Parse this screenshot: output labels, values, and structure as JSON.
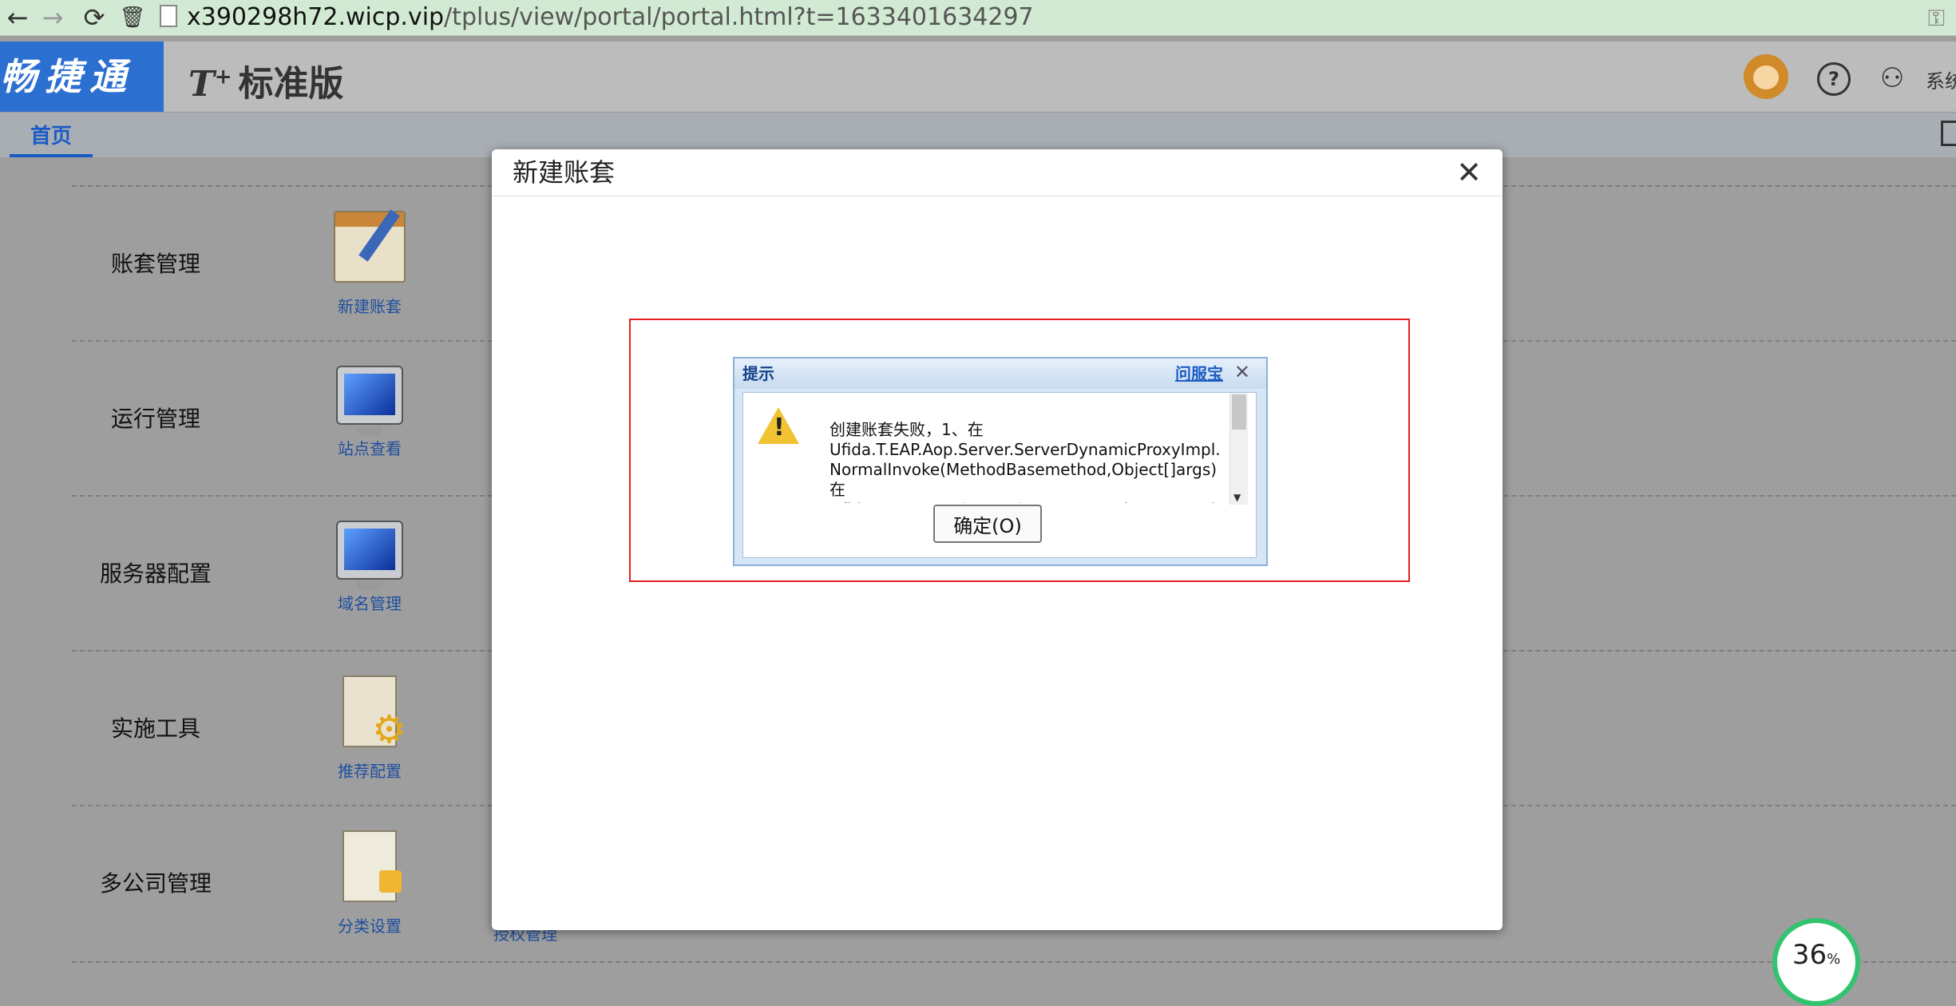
{
  "browser": {
    "back_icon": "←",
    "forward_icon": "→",
    "reload_icon": "⟳",
    "trash_icon": "🗑",
    "url_host": "x390298h72.wicp.vip",
    "url_path": "/tplus/view/portal/portal.html?t=1633401634297"
  },
  "header": {
    "brand": "畅捷通",
    "product_t": "T",
    "product_plus": "+",
    "product_name": "标准版",
    "user_truncated": "系统"
  },
  "tabs": [
    {
      "label": "首页"
    }
  ],
  "portal": {
    "rows": [
      {
        "title": "账套管理",
        "func": "新建账套"
      },
      {
        "title": "运行管理",
        "func": "站点查看"
      },
      {
        "title": "服务器配置",
        "func": "域名管理"
      },
      {
        "title": "实施工具",
        "func": "推荐配置"
      },
      {
        "title": "多公司管理",
        "func": "分类设置"
      }
    ],
    "peek_label": "授权管理"
  },
  "modal": {
    "title": "新建账套",
    "close_icon": "✕"
  },
  "dialog": {
    "title": "提示",
    "link": "问服宝",
    "close_icon": "✕",
    "message": "创建账套失败，1、在\nUfida.T.EAP.Aop.Server.ServerDynamicProxyImpl.NormalInvoke(MethodBasemethod,Object[]args)\n在\nUfida.T.EAP.Aop.Server.ServerDynamicProxyImpl.Invoke",
    "ok_label": "确定(O)"
  },
  "badge": {
    "value": "36",
    "unit": "%"
  },
  "colors": {
    "brand": "#2b6fd0",
    "tab_accent": "#1a5cc4",
    "alert_frame": "#e02020",
    "badge_ring": "#31c36d"
  }
}
